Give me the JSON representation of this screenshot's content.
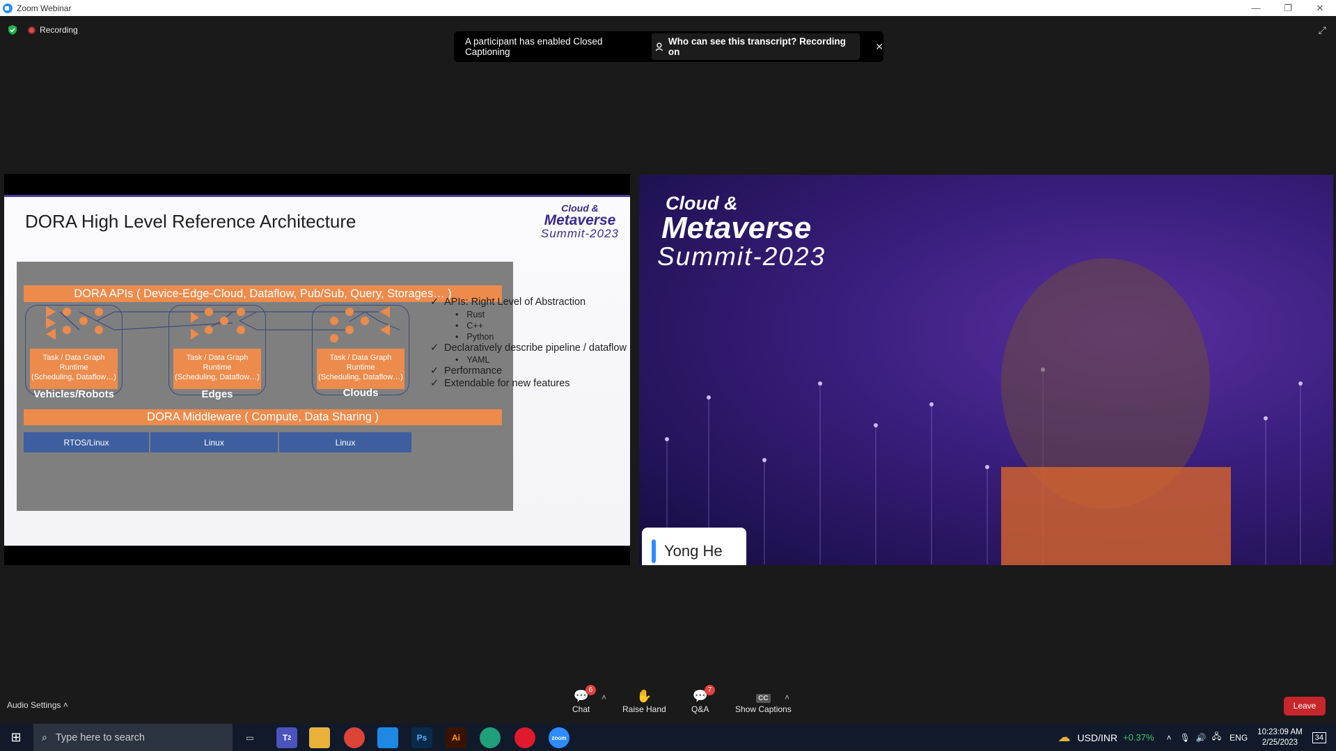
{
  "window": {
    "title": "Zoom Webinar"
  },
  "status": {
    "recording_label": "Recording"
  },
  "cc_banner": {
    "message": "A participant has enabled Closed Captioning",
    "who_label": "Who can see this transcript? Recording on"
  },
  "slide": {
    "title": "DORA High Level Reference Architecture",
    "logo": {
      "line1": "Cloud &",
      "line2": "Metaverse",
      "line3": "Summit-2023"
    },
    "apis_bar": "DORA APIs  ( Device-Edge-Cloud, Dataflow, Pub/Sub, Query, Storages… )",
    "middleware_bar": "DORA Middleware ( Compute, Data Sharing )",
    "groups": [
      {
        "label": "Vehicles/Robots",
        "task_line1": "Task / Data Graph",
        "task_line2": "Runtime",
        "task_line3": "(Scheduling, Dataflow…)"
      },
      {
        "label": "Edges",
        "task_line1": "Task / Data Graph",
        "task_line2": "Runtime",
        "task_line3": "(Scheduling, Dataflow…)"
      },
      {
        "label": "Clouds",
        "task_line1": "Task / Data Graph",
        "task_line2": "Runtime",
        "task_line3": "(Scheduling, Dataflow…)"
      }
    ],
    "os": [
      "RTOS/Linux",
      "Linux",
      "Linux"
    ],
    "bullets": {
      "b1": "APIs: Right Level of Abstraction",
      "b1_subs": [
        "Rust",
        "C++",
        "Python"
      ],
      "b2": "Declaratively describe pipeline / dataflow",
      "b2_subs": [
        "YAML"
      ],
      "b3": "Performance",
      "b4": "Extendable for new features",
      "check": "✓"
    }
  },
  "camera": {
    "logo": {
      "line1": "Cloud &",
      "line2": "Metaverse",
      "line3": "Summit-2023"
    },
    "participant_name": "Yong He"
  },
  "toolbar": {
    "audio_settings": "Audio Settings",
    "chat": {
      "label": "Chat",
      "badge": "6"
    },
    "raise_hand": {
      "label": "Raise Hand"
    },
    "qa": {
      "label": "Q&A",
      "badge": "7"
    },
    "captions": {
      "label": "Show Captions",
      "icon_text": "CC"
    },
    "leave": "Leave"
  },
  "taskbar": {
    "search_placeholder": "Type here to search",
    "teams_badge": "2",
    "ticker": "USD/INR",
    "ticker_change": "+0.37%",
    "language": "ENG",
    "time": "10:23:09 AM",
    "date": "2/25/2023",
    "notifications": "34"
  },
  "colors": {
    "accent_orange": "#ec8b4c",
    "os_blue": "#3e5ea0",
    "zoom_blue": "#2d8cff",
    "leave_red": "#c7262b"
  }
}
